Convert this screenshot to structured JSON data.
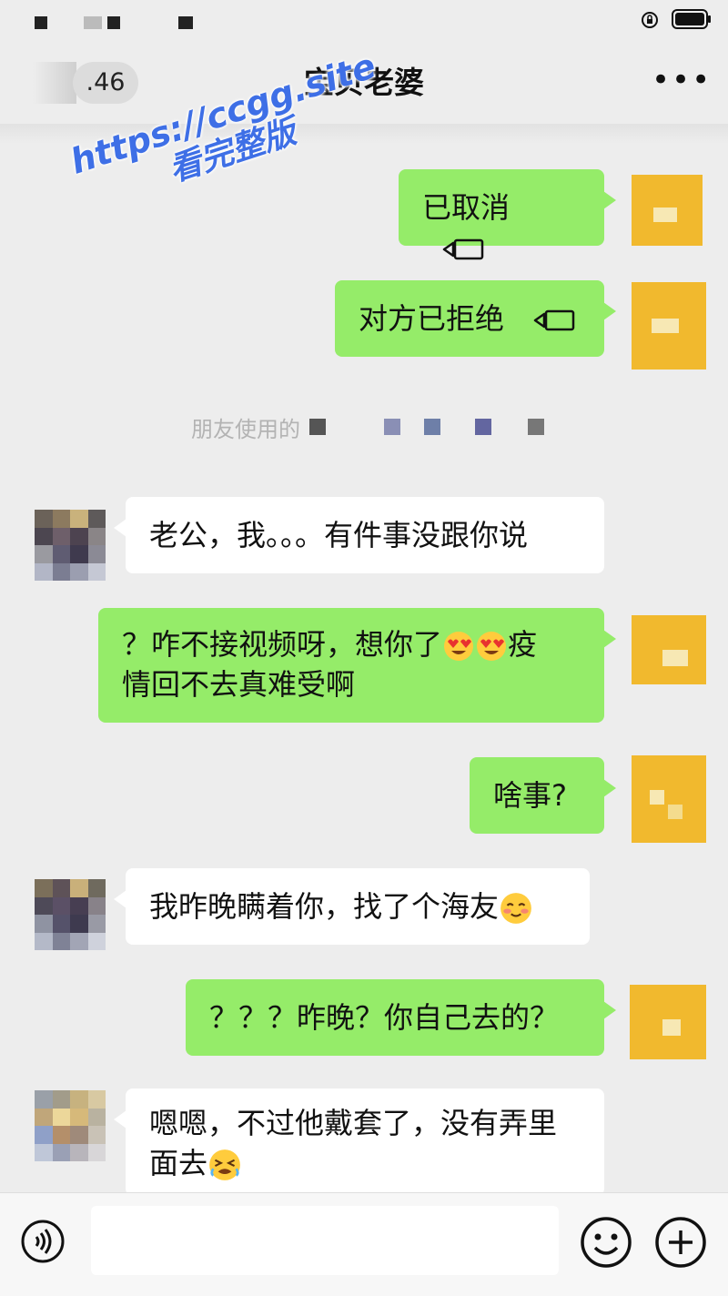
{
  "status_bar": {
    "icons": [
      "rotation-lock-icon",
      "battery-icon"
    ]
  },
  "nav": {
    "back_badge": ".46",
    "title": "宝贝老婆",
    "more": "•••"
  },
  "watermark": {
    "line1": "https://ccgg.site",
    "line2": "看完整版"
  },
  "system_message": "朋友使用的",
  "messages": [
    {
      "from": "me",
      "text": "已取消",
      "icon": "video-call-icon"
    },
    {
      "from": "me",
      "text": "对方已拒绝",
      "icon": "video-call-icon"
    },
    {
      "from": "her",
      "text": "老公，我。。。有件事没跟你说"
    },
    {
      "from": "me",
      "line1": "？咋不接视频呀，想你了",
      "line1_tail": "疫",
      "line2": "情回不去真难受啊",
      "emojis": [
        "heart-eyes-emoji",
        "heart-eyes-emoji"
      ]
    },
    {
      "from": "me",
      "text": "啥事?"
    },
    {
      "from": "her",
      "text": "我昨晚瞒着你，找了个海友",
      "emojis": [
        "blushing-emoji"
      ]
    },
    {
      "from": "me",
      "text": "？？？昨晚？你自己去的？"
    },
    {
      "from": "her",
      "line1": "嗯嗯，不过他戴套了，没有弄里",
      "line2": "面去",
      "emojis": [
        "tired-face-emoji"
      ]
    }
  ],
  "input_bar": {
    "icons": [
      "voice-icon",
      "emoji-icon",
      "plus-icon"
    ]
  },
  "colors": {
    "my_bubble": "#95ec69",
    "her_bubble": "#ffffff",
    "background": "#ededed",
    "watermark": "#3e6fe6"
  }
}
